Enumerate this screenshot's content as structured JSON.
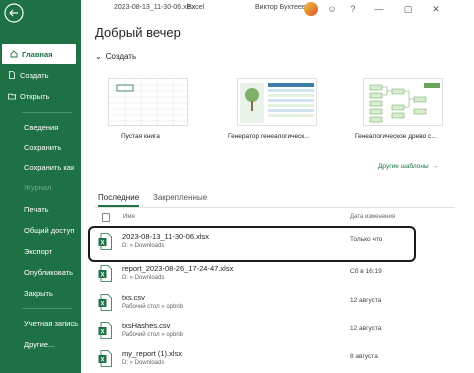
{
  "title_bar": {
    "file_name": "2023-08-13_11-30-06.xlsx",
    "app_name": "Excel",
    "user_name": "Виктор Бухтеев"
  },
  "sidebar": {
    "items": [
      {
        "label": "Главная",
        "icon": "home-icon",
        "active": true
      },
      {
        "label": "Создать",
        "icon": "new-file-icon"
      },
      {
        "label": "Открыть",
        "icon": "folder-open-icon"
      },
      {
        "label": "Сведения"
      },
      {
        "label": "Сохранить"
      },
      {
        "label": "Сохранить как"
      },
      {
        "label": "Журнал",
        "disabled": true
      },
      {
        "label": "Печать"
      },
      {
        "label": "Общий доступ"
      },
      {
        "label": "Экспорт"
      },
      {
        "label": "Опубликовать"
      },
      {
        "label": "Закрыть"
      },
      {
        "label": "Учетная запись"
      },
      {
        "label": "Другие..."
      }
    ]
  },
  "greeting": "Добрый вечер",
  "create_section": {
    "label": "Создать",
    "templates": [
      {
        "name": "Пустая книга"
      },
      {
        "name": "Генератор генеалогическ..."
      },
      {
        "name": "Генеалогическое древо с..."
      }
    ],
    "more_label": "Другие шаблоны"
  },
  "tabs": {
    "recent": "Последние",
    "pinned": "Закрепленные"
  },
  "file_list": {
    "col_name": "Имя",
    "col_date": "Дата изменения",
    "rows": [
      {
        "name": "2023-08-13_11-30-06.xlsx",
        "path": "D: » Downloads",
        "date": "Только что"
      },
      {
        "name": "report_2023-08-26_17-24-47.xlsx",
        "path": "D: » Downloads",
        "date": "Сб в 16:19"
      },
      {
        "name": "txs.csv",
        "path": "Рабочий стол » opbnb",
        "date": "12 августа"
      },
      {
        "name": "txsHashes.csv",
        "path": "Рабочий стол » opbnb",
        "date": "12 августа"
      },
      {
        "name": "my_report (1).xlsx",
        "path": "D: » Downloads",
        "date": "8 августа"
      }
    ]
  },
  "colors": {
    "sidebar_bg": "#1e7145",
    "accent": "#1e7145"
  }
}
